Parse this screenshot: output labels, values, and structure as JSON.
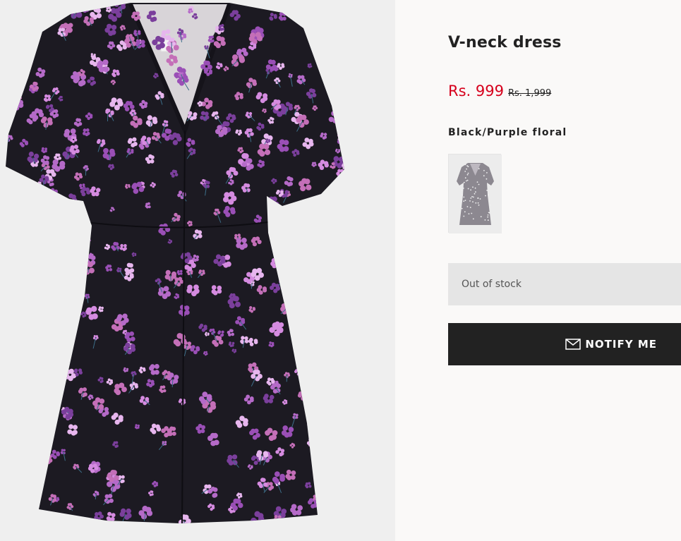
{
  "product": {
    "title": "V-neck dress",
    "price_current": "Rs. 999",
    "price_original": "Rs. 1,999",
    "color_name": "Black/Purple floral",
    "stock_status": "Out of stock",
    "notify_label": "NOTIFY ME",
    "notify_icon": "envelope-icon"
  },
  "colors": {
    "sale_price": "#d6001c",
    "button_bg": "#222222",
    "stock_bg": "#e5e5e5",
    "image_bg": "#efefef",
    "dress_base": "#1c1a22",
    "flower_main": "#b56ac8"
  }
}
